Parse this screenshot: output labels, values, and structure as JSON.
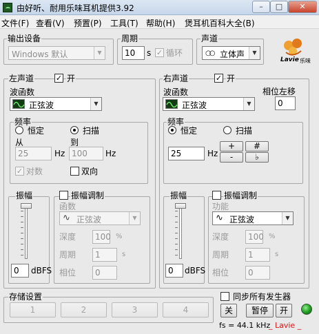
{
  "window": {
    "title": "由好听、耐用乐味耳机提供3.92",
    "minimize": "–",
    "maximize": "□",
    "close": "✕"
  },
  "menu": [
    "文件(F)",
    "查看(V)",
    "预置(P)",
    "工具(T)",
    "帮助(H)",
    "煲耳机百科大全(B)"
  ],
  "output": {
    "label": "输出设备",
    "device": "Windows 默认"
  },
  "period": {
    "label": "周期",
    "value": "10",
    "unit": "s",
    "loop_label": "循环"
  },
  "channel": {
    "label": "声道",
    "value": "立体声",
    "icon": "stereo-icon"
  },
  "brand": {
    "name": "Lavie",
    "sub": "乐味",
    "color": "#e07a1a"
  },
  "left": {
    "title": "左声道",
    "enable_label": "开",
    "wave_label": "波函数",
    "wave_value": "正弦波",
    "freq_label": "频率",
    "fixed_label": "恒定",
    "sweep_label": "扫描",
    "from_label": "从",
    "to_label": "到",
    "from_value": "25",
    "to_value": "100",
    "unit": "Hz",
    "log_label": "对数",
    "bidir_label": "双向",
    "amp_label": "振幅",
    "amp_value": "0",
    "amp_unit": "dBFS",
    "ammod_label": "振幅调制",
    "func_label": "函数",
    "func_value": "正弦波",
    "depth_label": "深度",
    "depth_value": "100",
    "depth_unit": "%",
    "period_label": "周期",
    "period_value": "1",
    "period_unit": "s",
    "phase_label": "相位",
    "phase_value": "0"
  },
  "right": {
    "title": "右声道",
    "enable_label": "开",
    "wave_label": "波函数",
    "wave_value": "正弦波",
    "phase_shift_label": "相位左移",
    "phase_shift_value": "0",
    "freq_label": "频率",
    "fixed_label": "恒定",
    "sweep_label": "扫描",
    "freq_value": "25",
    "unit": "Hz",
    "plus": "+",
    "minus": "-",
    "sharp": "#",
    "flat": "♭",
    "amp_label": "振幅",
    "amp_value": "0",
    "amp_unit": "dBFS",
    "ammod_label": "振幅调制",
    "func_label": "功能",
    "func_value": "正弦波",
    "depth_label": "深度",
    "depth_value": "100",
    "depth_unit": "%",
    "period_label": "周期",
    "period_value": "1",
    "period_unit": "s",
    "phase_label": "相位",
    "phase_value": "0"
  },
  "storage": {
    "label": "存储设置",
    "slots": [
      "1",
      "2",
      "3",
      "4"
    ]
  },
  "sync": {
    "label": "同步所有发生器"
  },
  "controls": {
    "off": "关",
    "pause": "暂停",
    "on": "开"
  },
  "status": {
    "sample_rate": "fs = 44.1 kHz",
    "brand": "_ Lavie _",
    "led_color": "#1e9a1e"
  }
}
